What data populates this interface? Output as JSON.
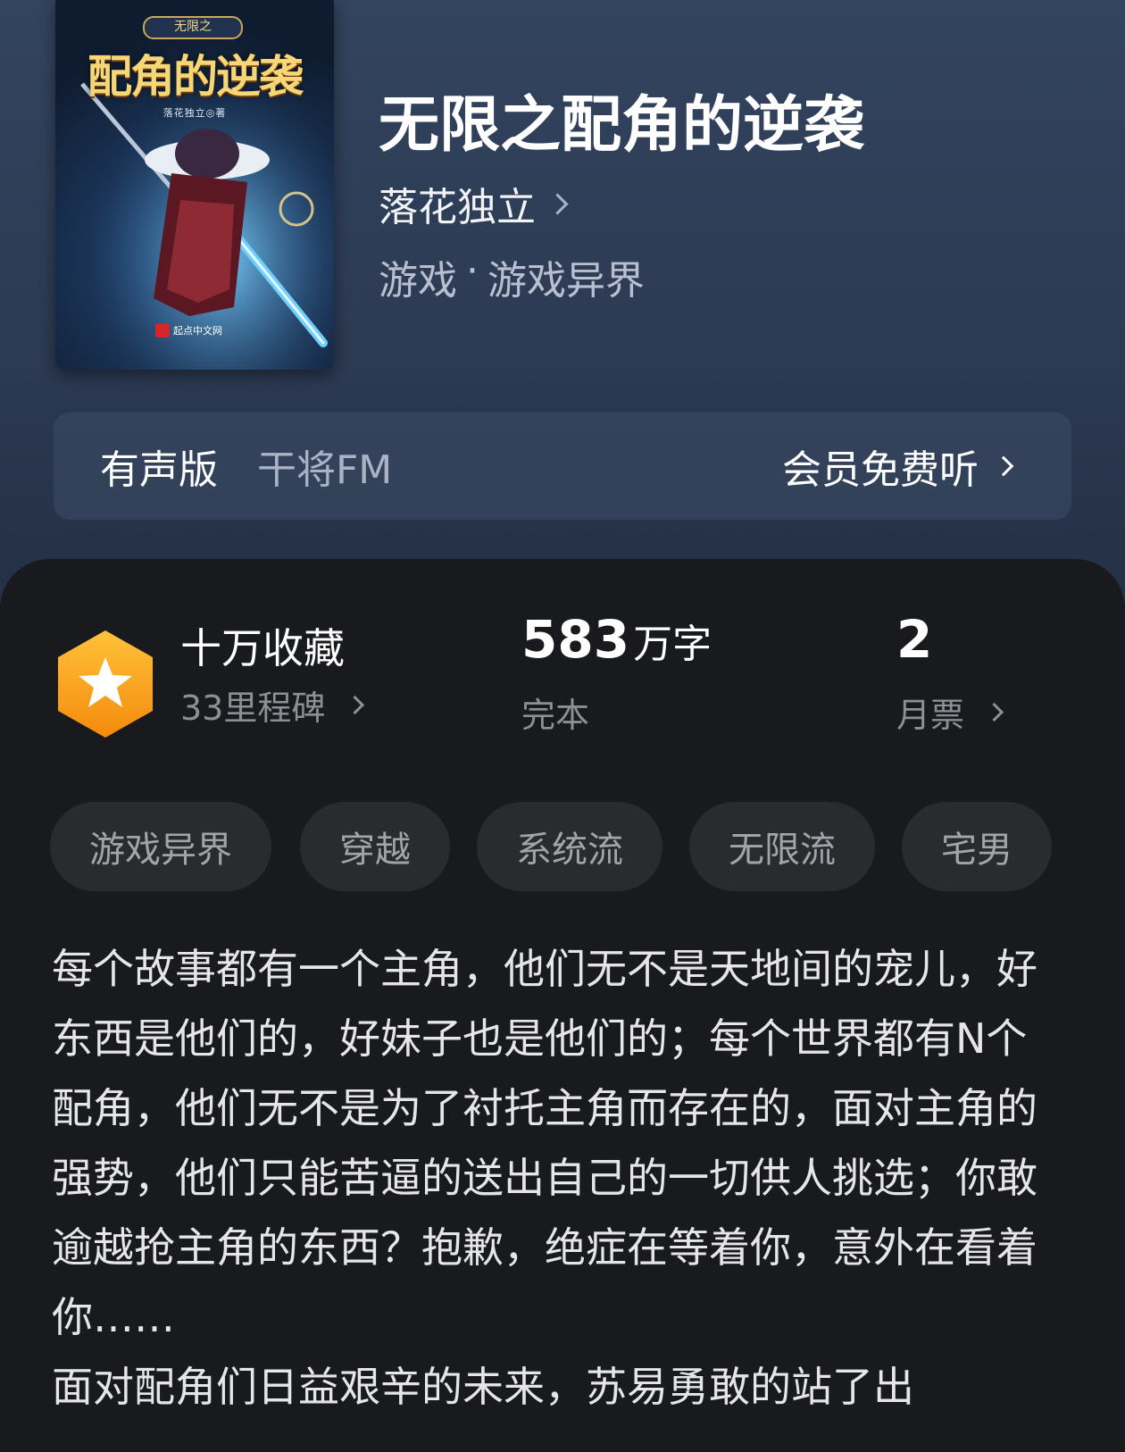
{
  "book": {
    "cover": {
      "series_label": "无限之",
      "title_text": "配角的逆袭",
      "author_text": "落花独立◎著",
      "publisher_text": "起点中文网"
    },
    "title": "无限之配角的逆袭",
    "author": "落花独立",
    "genre_main": "游戏",
    "genre_separator": "·",
    "genre_sub": "游戏异界"
  },
  "audio": {
    "label": "有声版",
    "provider": "干将FM",
    "action": "会员免费听"
  },
  "stats": {
    "collection": {
      "title": "十万收藏",
      "sub": "33里程碑"
    },
    "words": {
      "number": "583",
      "unit": "万字",
      "status": "完本"
    },
    "tickets": {
      "number": "2",
      "label": "月票"
    }
  },
  "tags": [
    "游戏异界",
    "穿越",
    "系统流",
    "无限流",
    "宅男"
  ],
  "synopsis": {
    "paragraph1": "每个故事都有一个主角，他们无不是天地间的宠儿，好东西是他们的，好妹子也是他们的；每个世界都有N个配角，他们无不是为了衬托主角而存在的，面对主角的强势，他们只能苦逼的送出自己的一切供人挑选；你敢逾越抢主角的东西？抱歉，绝症在等着你，意外在看着你……",
    "paragraph2": "面对配角们日益艰辛的未来，苏易勇敢的站了出"
  },
  "colors": {
    "medal_orange": "#f7a21b",
    "panel_bg": "#191a1d",
    "tag_bg": "#2a2b2f",
    "header_bg": "#2c3a52"
  }
}
